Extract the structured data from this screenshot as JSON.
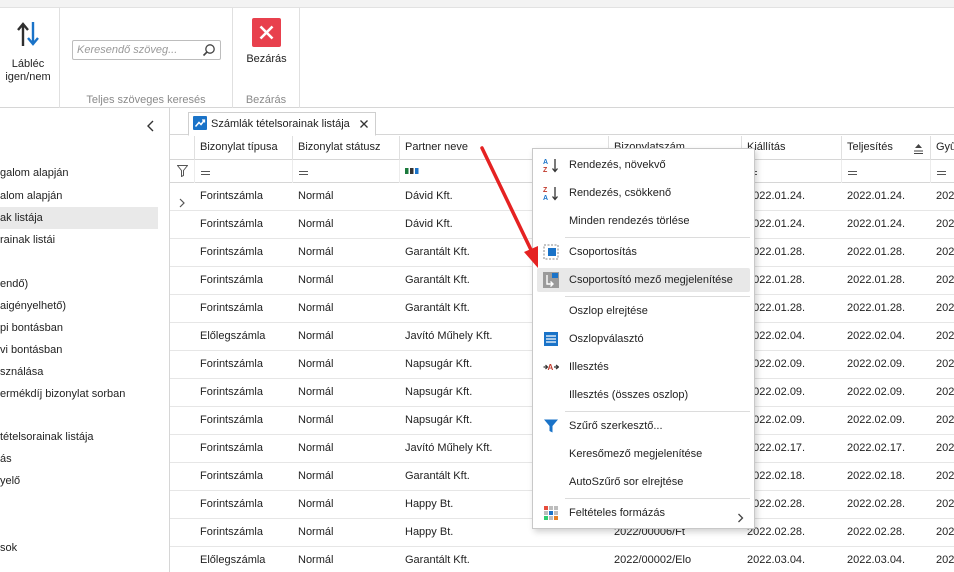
{
  "ribbon": {
    "footer_toggle_label": "Lábléc igen/nem",
    "search_placeholder": "Keresendő szöveg...",
    "search_group_caption": "Teljes szöveges keresés",
    "close_label": "Bezárás",
    "close_group_caption": "Bezárás"
  },
  "leftnav": {
    "items": [
      {
        "label": "galom alapján"
      },
      {
        "label": "alom alapján"
      },
      {
        "label": "ak listája"
      },
      {
        "label": "rainak listái"
      },
      {
        "label": ""
      },
      {
        "label": "endő)"
      },
      {
        "label": "aigényelhető)"
      },
      {
        "label": "pi bontásban"
      },
      {
        "label": "vi bontásban"
      },
      {
        "label": "sználása"
      },
      {
        "label": "ermékdíj bizonylat sorban"
      },
      {
        "label": ""
      },
      {
        "label": " tételsorainak listája"
      },
      {
        "label": "ás"
      },
      {
        "label": "yelő"
      },
      {
        "label": ""
      },
      {
        "label": ""
      },
      {
        "label": "sok"
      }
    ]
  },
  "tab": {
    "label": "Számlák tételsorainak listája"
  },
  "grid": {
    "columns": [
      {
        "label": "Bizonylat típusa"
      },
      {
        "label": "Bizonylat státusz"
      },
      {
        "label": "Partner neve"
      },
      {
        "label": "Bizonylatszám"
      },
      {
        "label": "Kiállítás"
      },
      {
        "label": "Teljesítés"
      },
      {
        "label": "Gyű"
      }
    ],
    "rows": [
      [
        "Forintszámla",
        "Normál",
        "Dávid Kft.",
        "",
        "2022.01.24.",
        "2022.01.24.",
        "202"
      ],
      [
        "Forintszámla",
        "Normál",
        "Dávid Kft.",
        "",
        "2022.01.24.",
        "2022.01.24.",
        "202"
      ],
      [
        "Forintszámla",
        "Normál",
        "Garantált Kft.",
        "",
        "2022.01.28.",
        "2022.01.28.",
        "202"
      ],
      [
        "Forintszámla",
        "Normál",
        "Garantált Kft.",
        "",
        "2022.01.28.",
        "2022.01.28.",
        "202"
      ],
      [
        "Forintszámla",
        "Normál",
        "Garantált Kft.",
        "",
        "2022.01.28.",
        "2022.01.28.",
        "202"
      ],
      [
        "Előlegszámla",
        "Normál",
        "Javító Műhely Kft.",
        "",
        "2022.02.04.",
        "2022.02.04.",
        "202"
      ],
      [
        "Forintszámla",
        "Normál",
        "Napsugár Kft.",
        "",
        "2022.02.09.",
        "2022.02.09.",
        "202"
      ],
      [
        "Forintszámla",
        "Normál",
        "Napsugár Kft.",
        "",
        "2022.02.09.",
        "2022.02.09.",
        "202"
      ],
      [
        "Forintszámla",
        "Normál",
        "Napsugár Kft.",
        "",
        "2022.02.09.",
        "2022.02.09.",
        "202"
      ],
      [
        "Forintszámla",
        "Normál",
        "Javító Műhely Kft.",
        "",
        "2022.02.17.",
        "2022.02.17.",
        "202"
      ],
      [
        "Forintszámla",
        "Normál",
        "Garantált Kft.",
        "",
        "2022.02.18.",
        "2022.02.18.",
        "202"
      ],
      [
        "Forintszámla",
        "Normál",
        "Happy Bt.",
        "",
        "2022.02.28.",
        "2022.02.28.",
        "202"
      ],
      [
        "Forintszámla",
        "Normál",
        "Happy Bt.",
        "2022/00006/Ft",
        "2022.02.28.",
        "2022.02.28.",
        "202"
      ],
      [
        "Előlegszámla",
        "Normál",
        "Garantált Kft.",
        "2022/00002/Elo",
        "2022.03.04.",
        "2022.03.04.",
        "202"
      ]
    ]
  },
  "context_menu": {
    "items": [
      {
        "label": "Rendezés, növekvő",
        "icon": "sort-ascending-icon"
      },
      {
        "label": "Rendezés, csökkenő",
        "icon": "sort-descending-icon"
      },
      {
        "label": "Minden rendezés törlése",
        "icon": ""
      },
      {
        "label": "Csoportosítás",
        "icon": "group-icon"
      },
      {
        "label": "Csoportosító mező megjelenítése",
        "icon": "group-panel-icon"
      },
      {
        "label": "Oszlop elrejtése",
        "icon": ""
      },
      {
        "label": "Oszlopválasztó",
        "icon": "column-chooser-icon"
      },
      {
        "label": "Illesztés",
        "icon": "best-fit-icon"
      },
      {
        "label": "Illesztés (összes oszlop)",
        "icon": ""
      },
      {
        "label": "Szűrő szerkesztő...",
        "icon": "filter-editor-icon"
      },
      {
        "label": "Keresőmező megjelenítése",
        "icon": ""
      },
      {
        "label": "AutoSzűrő sor elrejtése",
        "icon": ""
      },
      {
        "label": "Feltételes formázás",
        "icon": "conditional-format-icon"
      }
    ],
    "highlighted_index": 4
  },
  "colors": {
    "accent_blue": "#1a73c8",
    "close_red": "#e8404d",
    "annotation_arrow": "#e52222"
  }
}
